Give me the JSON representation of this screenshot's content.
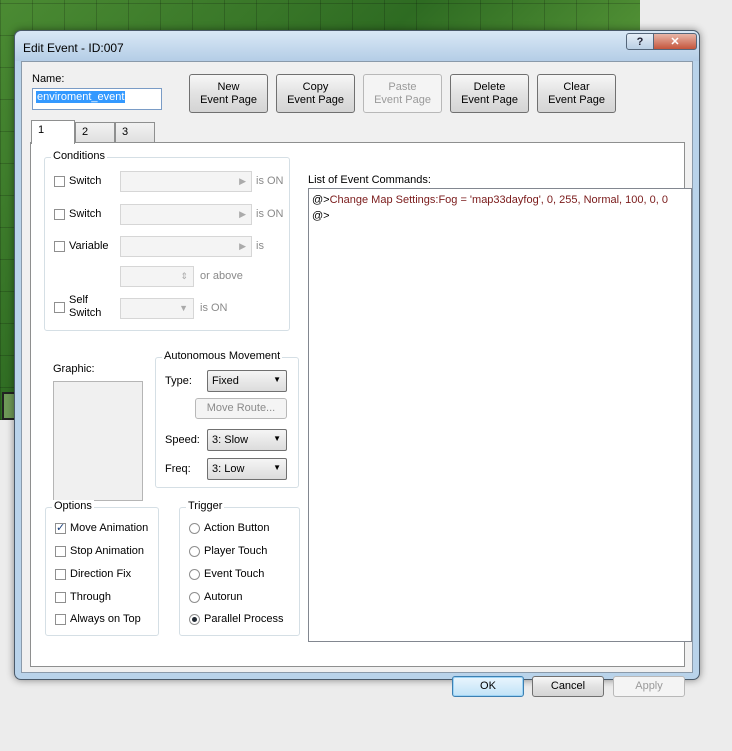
{
  "window": {
    "title": "Edit Event - ID:007",
    "help": "?",
    "close": "✕"
  },
  "name": {
    "label": "Name:",
    "value": "enviroment_event"
  },
  "toolbar": [
    {
      "line1": "New",
      "line2": "Event Page",
      "enabled": true
    },
    {
      "line1": "Copy",
      "line2": "Event Page",
      "enabled": true
    },
    {
      "line1": "Paste",
      "line2": "Event Page",
      "enabled": false
    },
    {
      "line1": "Delete",
      "line2": "Event Page",
      "enabled": true
    },
    {
      "line1": "Clear",
      "line2": "Event Page",
      "enabled": true
    }
  ],
  "tabs": [
    "1",
    "2",
    "3"
  ],
  "conditions": {
    "title": "Conditions",
    "switch1_label": "Switch",
    "switch1_suffix": "is ON",
    "switch2_label": "Switch",
    "switch2_suffix": "is ON",
    "variable_label": "Variable",
    "variable_suffix": "is",
    "or_above": "or above",
    "self_switch_line1": "Self",
    "self_switch_line2": "Switch",
    "self_switch_suffix": "is ON"
  },
  "graphic": {
    "label": "Graphic:"
  },
  "autonomous": {
    "title": "Autonomous Movement",
    "type_label": "Type:",
    "type_value": "Fixed",
    "move_route": "Move Route...",
    "speed_label": "Speed:",
    "speed_value": "3: Slow",
    "freq_label": "Freq:",
    "freq_value": "3: Low"
  },
  "options": {
    "title": "Options",
    "items": [
      {
        "label": "Move Animation",
        "checked": true
      },
      {
        "label": "Stop Animation",
        "checked": false
      },
      {
        "label": "Direction Fix",
        "checked": false
      },
      {
        "label": "Through",
        "checked": false
      },
      {
        "label": "Always on Top",
        "checked": false
      }
    ]
  },
  "trigger": {
    "title": "Trigger",
    "items": [
      {
        "label": "Action Button",
        "selected": false
      },
      {
        "label": "Player Touch",
        "selected": false
      },
      {
        "label": "Event Touch",
        "selected": false
      },
      {
        "label": "Autorun",
        "selected": false
      },
      {
        "label": "Parallel Process",
        "selected": true
      }
    ]
  },
  "commands": {
    "label": "List of Event Commands:",
    "prefix": "@>",
    "line1_text": "Change Map Settings:Fog = 'map33dayfog', 0, 255, Normal, 100, 0, 0",
    "line2": "@>"
  },
  "footer": {
    "ok": "OK",
    "cancel": "Cancel",
    "apply": "Apply"
  }
}
